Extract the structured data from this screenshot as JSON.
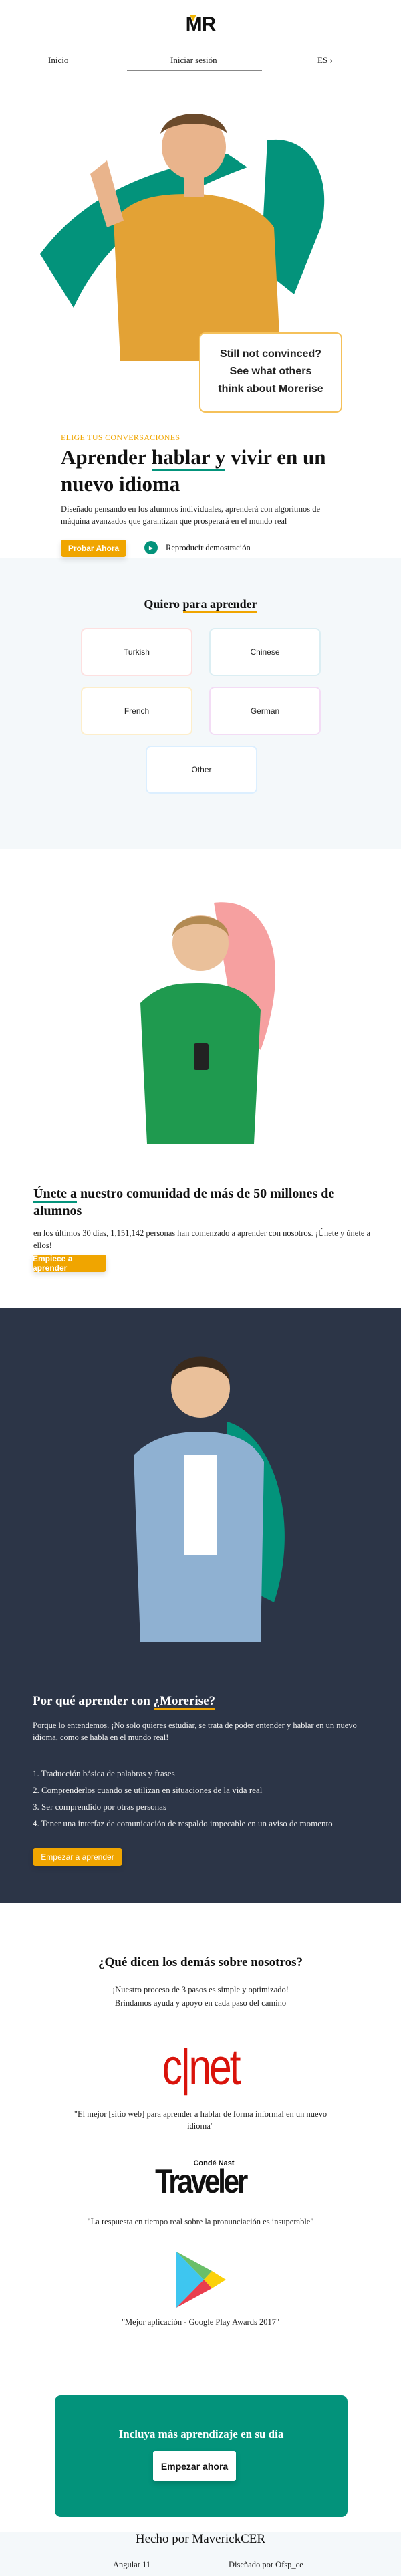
{
  "header": {
    "logo": "MR",
    "nav": {
      "home": "Inicio",
      "login": "Iniciar sesión",
      "language": "ES"
    }
  },
  "hero": {
    "card_lines": [
      "Still not convinced?",
      "See what others",
      "think about Morerise"
    ],
    "eyebrow": "ELIGE TUS CONVERSACIONES",
    "title_a": "Aprender ",
    "title_b": "hablar y",
    "title_c": " vivir en un nuevo idioma",
    "description": "Diseñado pensando en los alumnos individuales, aprenderá con algoritmos de máquina avanzados que garantizan que prosperará en el mundo real",
    "try_button": "Probar Ahora",
    "demo_link": "Reproducir demostración"
  },
  "languages": {
    "title_a": "Quiero ",
    "title_b": "para aprender",
    "options": [
      "Turkish",
      "Chinese",
      "French",
      "German",
      "Other"
    ]
  },
  "community": {
    "title_a": "Únete a",
    "title_b": " nuestro comunidad de más de 50 millones de alumnos",
    "text": "en los últimos 30 días, 1,151,142 personas han comenzado a aprender con nosotros. ¡Únete y únete a ellos!",
    "button": "Empiece a aprender"
  },
  "why": {
    "title_a": "Por qué aprender con ",
    "title_b": "¿Morerise?",
    "text": "Porque lo entendemos. ¡No solo quieres estudiar, se trata de poder entender y hablar en un nuevo idioma, como se habla en el mundo real!",
    "items": [
      "1.  Traducción básica de palabras y frases",
      "2.  Comprenderlos cuando se utilizan en situaciones de la vida real",
      "3.  Ser comprendido por otras personas",
      "4.  Tener una interfaz de comunicación de respaldo impecable en un aviso de momento"
    ],
    "button": "Empezar a aprender"
  },
  "testimonials": {
    "title": "¿Qué dicen los demás sobre nosotros?",
    "sub1": "¡Nuestro proceso de 3 pasos es simple y optimizado!",
    "sub2": "Brindamos ayuda y apoyo en cada paso del camino",
    "cnet_logo": "c|net",
    "cnet_quote": "\"El mejor [sitio web] para aprender a hablar de forma informal en un nuevo idioma\"",
    "traveler_logo_small": "Condé Nast",
    "traveler_logo": "Traveler",
    "traveler_quote": "\"La respuesta en tiempo real sobre la pronunciación es insuperable\"",
    "play_quote": "\"Mejor aplicación - Google Play Awards 2017\""
  },
  "cta": {
    "title": "Incluya más aprendizaje en su día",
    "button": "Empezar ahora"
  },
  "footer": {
    "made_by": "Hecho por MaverickCER",
    "framework": "Angular 11",
    "designed_by": "Diseñado por Ofsp_ce"
  },
  "colors": {
    "accent": "#f0a500",
    "green": "#03937b",
    "dark": "#2c3547"
  }
}
